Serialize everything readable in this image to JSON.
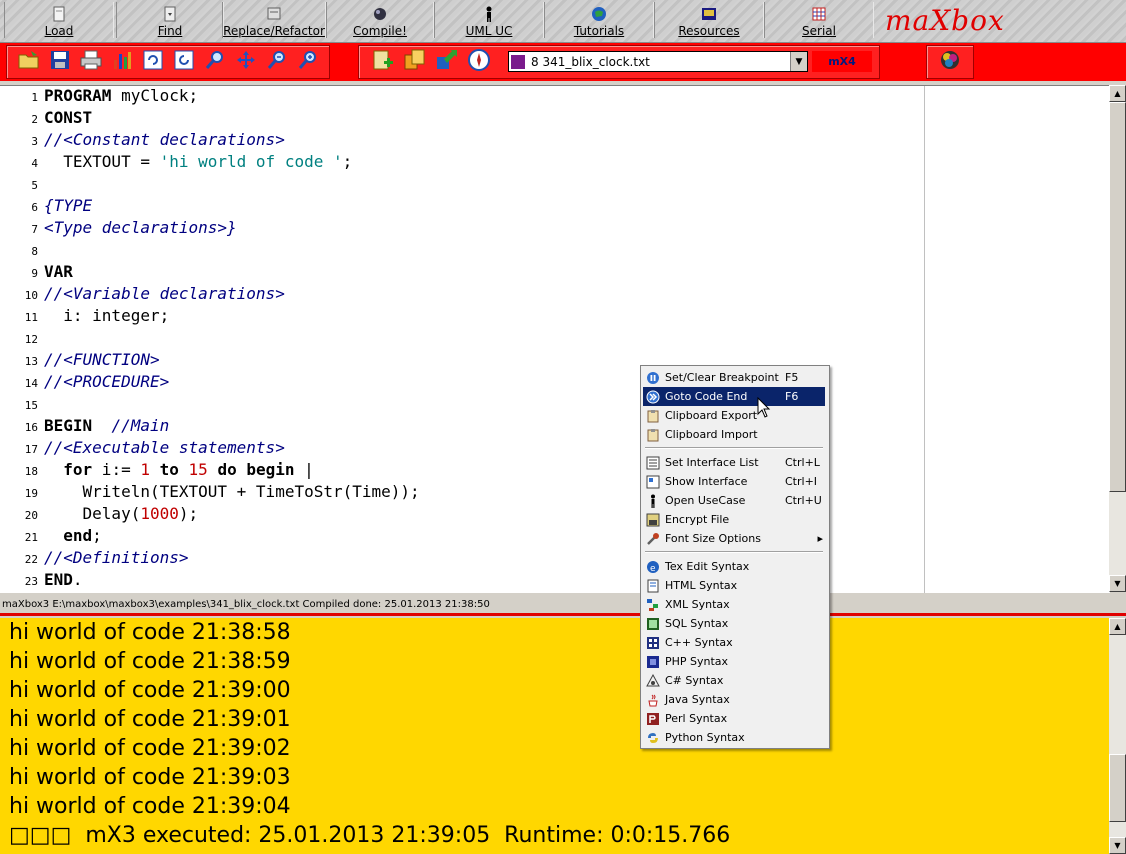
{
  "toolbar": {
    "buttons": [
      {
        "label": "Load"
      },
      {
        "label": "Find"
      },
      {
        "label": "Replace/Refactor"
      },
      {
        "label": "Compile!"
      },
      {
        "label": "UML UC"
      },
      {
        "label": "Tutorials"
      },
      {
        "label": "Resources"
      },
      {
        "label": "Serial"
      }
    ],
    "logo": "maXbox"
  },
  "filebar": {
    "selected_file": "8  341_blix_clock.txt",
    "mode_label": "mX4"
  },
  "editor": {
    "line_numbers": [
      "1",
      "2",
      "3",
      "4",
      "5",
      "6",
      "7",
      "8",
      "9",
      "10",
      "11",
      "12",
      "13",
      "14",
      "15",
      "16",
      "17",
      "18",
      "19",
      "20",
      "21",
      "22",
      "23"
    ]
  },
  "status": {
    "text": "maXbox3 E:\\maxbox\\maxbox3\\examples\\341_blix_clock.txt Compiled done: 25.01.2013 21:38:50"
  },
  "output": {
    "lines": [
      "hi world of code 21:38:58",
      "hi world of code 21:38:59",
      "hi world of code 21:39:00",
      "hi world of code 21:39:01",
      "hi world of code 21:39:02",
      "hi world of code 21:39:03",
      "hi world of code 21:39:04",
      "□□□  mX3 executed: 25.01.2013 21:39:05  Runtime: 0:0:15.766"
    ]
  },
  "context_menu": {
    "items": [
      {
        "label": "Set/Clear Breakpoint",
        "shortcut": "F5"
      },
      {
        "label": "Goto Code End",
        "shortcut": "F6"
      },
      {
        "label": "Clipboard Export",
        "shortcut": ""
      },
      {
        "label": "Clipboard Import",
        "shortcut": ""
      },
      {
        "label": "Set Interface List",
        "shortcut": "Ctrl+L"
      },
      {
        "label": "Show Interface",
        "shortcut": "Ctrl+I"
      },
      {
        "label": "Open UseCase",
        "shortcut": "Ctrl+U"
      },
      {
        "label": "Encrypt File",
        "shortcut": ""
      },
      {
        "label": "Font Size Options",
        "shortcut": "▸"
      },
      {
        "label": "Tex Edit Syntax",
        "shortcut": ""
      },
      {
        "label": "HTML Syntax",
        "shortcut": ""
      },
      {
        "label": "XML Syntax",
        "shortcut": ""
      },
      {
        "label": "SQL Syntax",
        "shortcut": ""
      },
      {
        "label": "C++ Syntax",
        "shortcut": ""
      },
      {
        "label": "PHP Syntax",
        "shortcut": ""
      },
      {
        "label": "C# Syntax",
        "shortcut": ""
      },
      {
        "label": "Java Syntax",
        "shortcut": ""
      },
      {
        "label": "Perl Syntax",
        "shortcut": ""
      },
      {
        "label": "Python Syntax",
        "shortcut": ""
      }
    ]
  },
  "code": {
    "l1_kw": "PROGRAM",
    "l1_rest": " myClock;",
    "l2_kw": "CONST",
    "l3_cm": "//<Constant declarations>",
    "l4_a": "  TEXTOUT = ",
    "l4_str": "'hi world of code '",
    "l4_b": ";",
    "l6_cm": "{TYPE",
    "l7_cm": "<Type declarations>}",
    "l9_kw": "VAR",
    "l10_cm": "//<Variable declarations>",
    "l11": "  i: integer;",
    "l13_cm": "//<FUNCTION>",
    "l14_cm": "//<PROCEDURE>",
    "l16_kw": "BEGIN",
    "l16_cm": "  //Main",
    "l17_cm": "//<Executable statements>",
    "l18_a": "  ",
    "l18_kw1": "for",
    "l18_b": " i:= ",
    "l18_n1": "1",
    "l18_c": " ",
    "l18_kw2": "to",
    "l18_d": " ",
    "l18_n2": "15",
    "l18_e": " ",
    "l18_kw3": "do",
    "l18_f": " ",
    "l18_kw4": "begin",
    "l18_g": " |",
    "l19": "    Writeln(TEXTOUT + TimeToStr(Time));",
    "l20_a": "    Delay(",
    "l20_n": "1000",
    "l20_b": ");",
    "l21_a": "  ",
    "l21_kw": "end",
    "l21_b": ";",
    "l22_cm": "//<Definitions>",
    "l23_kw": "END",
    "l23_b": "."
  }
}
